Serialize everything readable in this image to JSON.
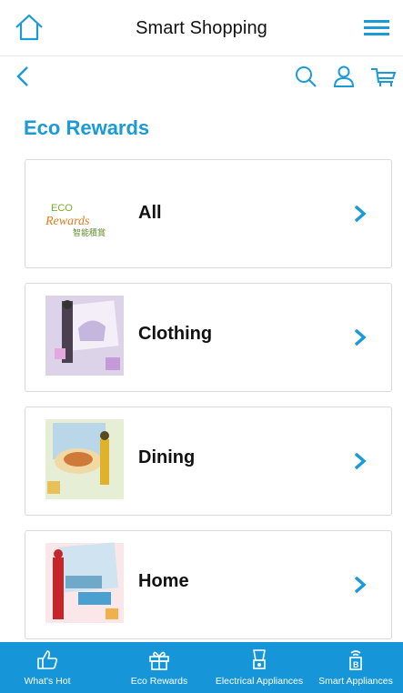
{
  "header": {
    "title": "Smart Shopping"
  },
  "page": {
    "section_title": "Eco Rewards"
  },
  "categories": [
    {
      "label": "All",
      "image": "eco-rewards-logo"
    },
    {
      "label": "Clothing",
      "image": "clothing-photo"
    },
    {
      "label": "Dining",
      "image": "dining-photo"
    },
    {
      "label": "Home",
      "image": "home-photo"
    }
  ],
  "logo": {
    "line1": "ECO",
    "line2": "Rewards",
    "line3": "智能積賞"
  },
  "bottom_nav": [
    {
      "label": "What's Hot",
      "icon": "thumbs-up-icon"
    },
    {
      "label": "Eco Rewards",
      "icon": "gift-icon"
    },
    {
      "label": "Electrical Appliances",
      "icon": "blender-icon"
    },
    {
      "label": "Smart Appliances",
      "icon": "smart-appliance-icon"
    }
  ],
  "colors": {
    "accent": "#1a9ad6",
    "nav_bg": "#1696d9",
    "text": "#111111",
    "card_border": "#d9d9d9"
  }
}
